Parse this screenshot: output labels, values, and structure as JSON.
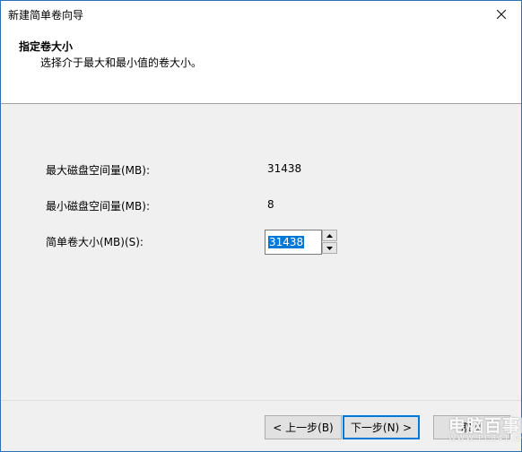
{
  "window": {
    "title": "新建简单卷向导",
    "close_icon": "close-icon"
  },
  "header": {
    "title": "指定卷大小",
    "subtitle": "选择介于最大和最小值的卷大小。"
  },
  "fields": {
    "max_label": "最大磁盘空间量(MB):",
    "max_value": "31438",
    "min_label": "最小磁盘空间量(MB):",
    "min_value": "8",
    "size_label": "简单卷大小(MB)(S):",
    "size_value": "31438"
  },
  "buttons": {
    "back": "< 上一步(B)",
    "next": "下一步(N) >",
    "cancel": "取消"
  },
  "watermark": {
    "text": "电脑百事网",
    "subtext": "WWW.PC841.COM"
  },
  "colors": {
    "accent": "#0078d7",
    "selection": "#0078d7",
    "window_border": "#2f6fb3"
  }
}
